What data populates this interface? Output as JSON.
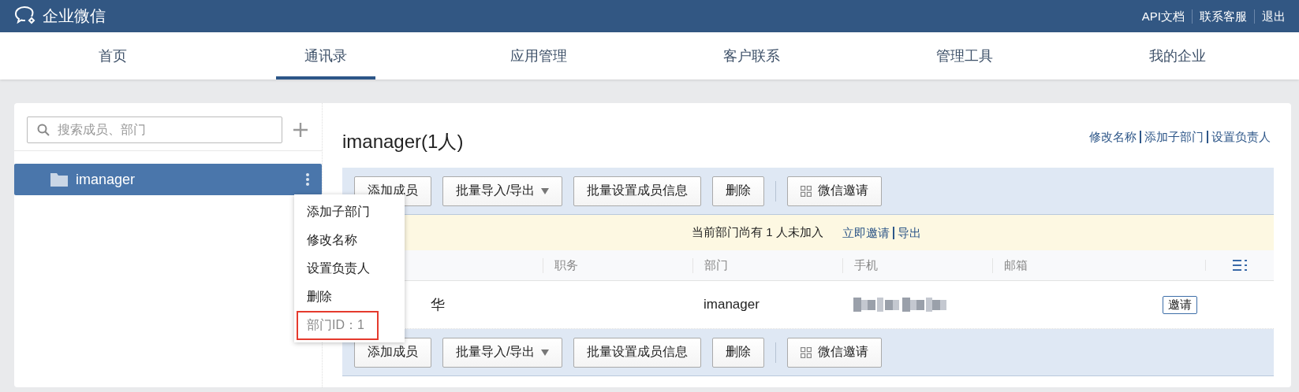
{
  "app": {
    "title": "企业微信",
    "links": [
      "API文档",
      "联系客服",
      "退出"
    ]
  },
  "nav": [
    {
      "label": "首页",
      "selected": false
    },
    {
      "label": "通讯录",
      "selected": true
    },
    {
      "label": "应用管理",
      "selected": false
    },
    {
      "label": "客户联系",
      "selected": false
    },
    {
      "label": "管理工具",
      "selected": false
    },
    {
      "label": "我的企业",
      "selected": false
    }
  ],
  "sidebar": {
    "search": {
      "placeholder": "搜索成员、部门"
    },
    "tree": [
      {
        "label": "imanager",
        "selected": true
      }
    ]
  },
  "context_menu": [
    {
      "label": "添加子部门",
      "kind": "action",
      "highlighted": false
    },
    {
      "label": "修改名称",
      "kind": "action",
      "highlighted": false
    },
    {
      "label": "设置负责人",
      "kind": "action",
      "highlighted": false
    },
    {
      "label": "删除",
      "kind": "action",
      "highlighted": false
    },
    {
      "label": "部门ID：1",
      "kind": "info",
      "highlighted": true
    }
  ],
  "department": {
    "title": "imanager(1人)",
    "links": [
      "修改名称",
      "添加子部门",
      "设置负责人"
    ]
  },
  "toolbar_top": [
    {
      "label": "添加成员",
      "kind": "button"
    },
    {
      "label": "批量导入/导出",
      "kind": "dropdown"
    },
    {
      "label": "批量设置成员信息",
      "kind": "button"
    },
    {
      "label": "删除",
      "kind": "button"
    },
    {
      "label": "微信邀请",
      "kind": "qr"
    }
  ],
  "notice": {
    "text": "当前部门尚有 1 人未加入",
    "links": [
      "立即邀请",
      "导出"
    ]
  },
  "table": {
    "columns": [
      "职务",
      "部门",
      "手机",
      "邮箱"
    ],
    "rows": [
      {
        "name": "华",
        "department": "imanager",
        "action": "邀请"
      }
    ]
  },
  "toolbar_bottom": [
    {
      "label": "添加成员",
      "kind": "button"
    },
    {
      "label": "批量导入/导出",
      "kind": "dropdown"
    },
    {
      "label": "批量设置成员信息",
      "kind": "button"
    },
    {
      "label": "删除",
      "kind": "button"
    },
    {
      "label": "微信邀请",
      "kind": "qr"
    }
  ]
}
